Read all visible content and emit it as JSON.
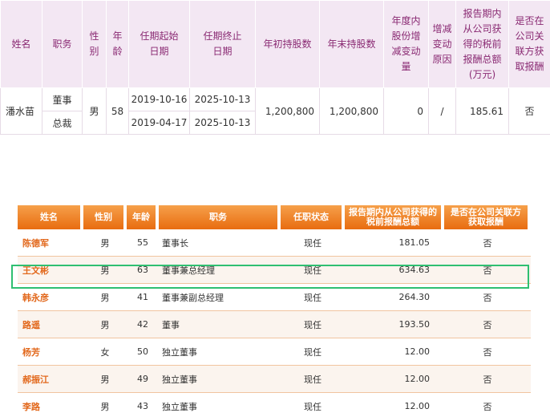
{
  "top_table": {
    "headers": [
      "姓名",
      "职务",
      "性别",
      "年龄",
      "任期起始日期",
      "任期终止日期",
      "年初持股数",
      "年末持股数",
      "年度内股份增减变动量",
      "增减变动原因",
      "报告期内从公司获得的税前报酬总额(万元)",
      "是否在公司关联方获取报酬"
    ],
    "header_lines": [
      [
        "姓名"
      ],
      [
        "职务"
      ],
      [
        "性",
        "别"
      ],
      [
        "年",
        "龄"
      ],
      [
        "任期起始",
        "日期"
      ],
      [
        "任期终止",
        "日期"
      ],
      [
        "年初持股数"
      ],
      [
        "年末持股数"
      ],
      [
        "年度内",
        "股份增",
        "减变动",
        "量"
      ],
      [
        "增减",
        "变动",
        "原因"
      ],
      [
        "报告期内",
        "从公司获",
        "得的税前",
        "报酬总额",
        "(万元)"
      ],
      [
        "是否在",
        "公司关",
        "联方获",
        "取报酬"
      ]
    ],
    "row": {
      "name": "潘水苗",
      "positions": [
        "董事",
        "总裁"
      ],
      "gender": "男",
      "age": "58",
      "start_dates": [
        "2019-10-16",
        "2019-04-17"
      ],
      "end_dates": [
        "2025-10-13",
        "2025-10-13"
      ],
      "shares_begin": "1,200,800",
      "shares_end": "1,200,800",
      "change": "0",
      "reason": "/",
      "pay": "185.61",
      "related": "否"
    }
  },
  "bottom_table": {
    "headers": [
      "姓名",
      "性别",
      "年龄",
      "职务",
      "任职状态",
      "报告期内从公司获得的税前报酬总额",
      "是否在公司关联方获取报酬"
    ],
    "header_lines": [
      [
        "姓名"
      ],
      [
        "性别"
      ],
      [
        "年龄"
      ],
      [
        "职务"
      ],
      [
        "任职状态"
      ],
      [
        "报告期内从公司获得的",
        "税前报酬总额"
      ],
      [
        "是否在公司关联方",
        "获取报酬"
      ]
    ],
    "rows": [
      {
        "name": "陈德军",
        "gender": "男",
        "age": "55",
        "position": "董事长",
        "status": "现任",
        "pay": "181.05",
        "related": "否"
      },
      {
        "name": "王文彬",
        "gender": "男",
        "age": "63",
        "position": "董事兼总经理",
        "status": "现任",
        "pay": "634.63",
        "related": "否"
      },
      {
        "name": "韩永彦",
        "gender": "男",
        "age": "41",
        "position": "董事兼副总经理",
        "status": "现任",
        "pay": "264.30",
        "related": "否"
      },
      {
        "name": "路遥",
        "gender": "男",
        "age": "42",
        "position": "董事",
        "status": "现任",
        "pay": "193.50",
        "related": "否"
      },
      {
        "name": "杨芳",
        "gender": "女",
        "age": "50",
        "position": "独立董事",
        "status": "现任",
        "pay": "12.00",
        "related": "否"
      },
      {
        "name": "郝振江",
        "gender": "男",
        "age": "49",
        "position": "独立董事",
        "status": "现任",
        "pay": "12.00",
        "related": "否"
      },
      {
        "name": "李路",
        "gender": "男",
        "age": "43",
        "position": "独立董事",
        "status": "现任",
        "pay": "12.00",
        "related": "否"
      }
    ]
  },
  "colors": {
    "top_header_bg": "#f3e7f3",
    "top_header_text": "#8a2a73",
    "bottom_header": "#e86c10",
    "bottom_name_text": "#e2681c",
    "highlight": "#2fbf71"
  }
}
